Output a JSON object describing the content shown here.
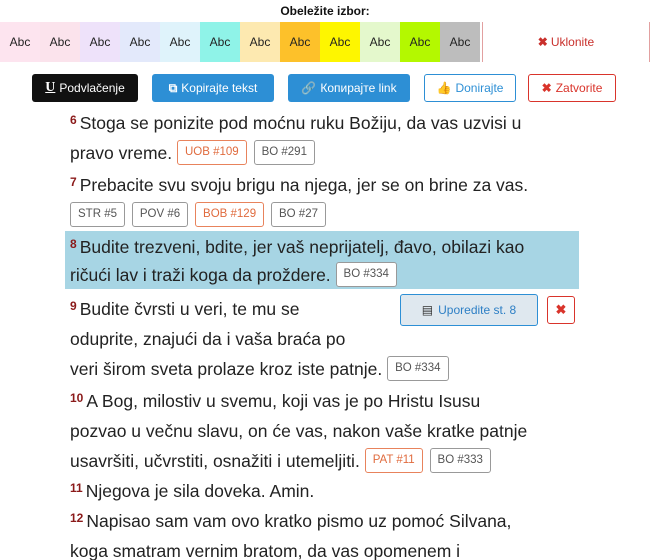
{
  "highlight": {
    "title": "Obeležite izbor:",
    "swatches": [
      {
        "label": "Abc",
        "color": "#fde4ef"
      },
      {
        "label": "Abc",
        "color": "#fbe3ec"
      },
      {
        "label": "Abc",
        "color": "#eee2fa"
      },
      {
        "label": "Abc",
        "color": "#e3e9fb"
      },
      {
        "label": "Abc",
        "color": "#dff3fb"
      },
      {
        "label": "Abc",
        "color": "#8ff3e8"
      },
      {
        "label": "Abc",
        "color": "#fde9b0"
      },
      {
        "label": "Abc",
        "color": "#fdc12a"
      },
      {
        "label": "Abc",
        "color": "#fef600"
      },
      {
        "label": "Abc",
        "color": "#e4f8cc"
      },
      {
        "label": "Abc",
        "color": "#b4f800"
      },
      {
        "label": "Abc",
        "color": "#bdbdbd"
      }
    ],
    "remove_label": "Uklonite"
  },
  "toolbar": {
    "underline_label": "Podvlačenje",
    "copy_text_label": "Kopirajte tekst",
    "copy_link_label": "Копирајте link",
    "donate_label": "Donirajte",
    "close_label": "Zatvorite"
  },
  "verses": {
    "v6": {
      "num": "6",
      "line1": "Stoga se ponizite pod moćnu ruku Božiju, da vas uzvisi u",
      "line2": "pravo vreme.",
      "refs": [
        "UOB #109",
        "BO #291"
      ]
    },
    "v7": {
      "num": "7",
      "line1": "Prebacite svu svoju brigu na njega, jer se on brine za vas.",
      "refs": [
        "STR #5",
        "POV #6",
        "BOB #129",
        "BO #27"
      ]
    },
    "v8": {
      "num": "8",
      "line1": "Budite trezveni, bdite, jer vaš neprijatelj, đavo, obilazi kao",
      "line2": "ričući lav i traži koga da proždere.",
      "refs": [
        "BO #334"
      ]
    },
    "v9": {
      "num": "9",
      "line1": "Budite čvrsti u veri, te mu se",
      "line2": "oduprite, znajući da i vaša braća po",
      "line3": "veri širom sveta prolaze kroz iste patnje.",
      "refs": [
        "BO #334"
      ]
    },
    "v10": {
      "num": "10",
      "line1": "A Bog, milostiv u svemu, koji vas je po Hristu Isusu",
      "line2": "pozvao u večnu slavu, on će vas, nakon vaše kratke patnje",
      "line3": "usavršiti, učvrstiti, osnažiti i utemeljiti.",
      "refs": [
        "PAT #11",
        "BO #333"
      ]
    },
    "v11": {
      "num": "11",
      "line1": "Njegova je sila doveka. Amin."
    },
    "v12": {
      "num": "12",
      "line1": "Napisao sam vam ovo kratko pismo uz pomoć Silvana,",
      "line2": "koga smatram vernim bratom, da vas opomenem i"
    }
  },
  "compare": {
    "label": "Uporedite st. 8"
  }
}
